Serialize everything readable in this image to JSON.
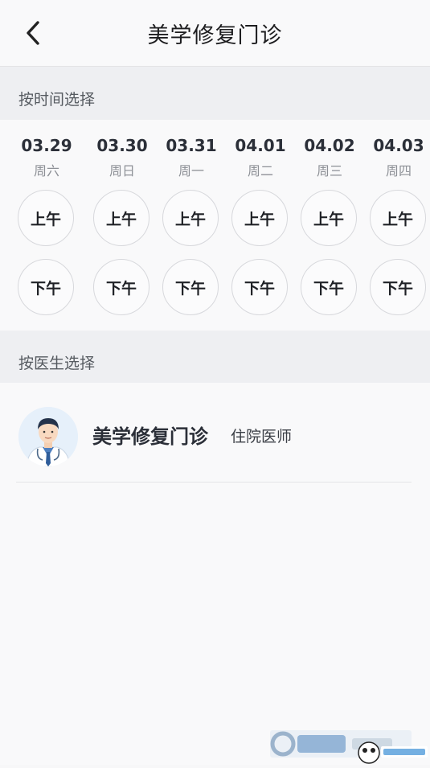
{
  "header": {
    "title": "美学修复门诊",
    "back_icon": "chevron-left-icon"
  },
  "time_section": {
    "label": "按时间选择",
    "days": [
      {
        "date": "03.29",
        "weekday": "周六",
        "am": "上午",
        "pm": "下午"
      },
      {
        "date": "03.30",
        "weekday": "周日",
        "am": "上午",
        "pm": "下午"
      },
      {
        "date": "03.31",
        "weekday": "周一",
        "am": "上午",
        "pm": "下午"
      },
      {
        "date": "04.01",
        "weekday": "周二",
        "am": "上午",
        "pm": "下午"
      },
      {
        "date": "04.02",
        "weekday": "周三",
        "am": "上午",
        "pm": "下午"
      },
      {
        "date": "04.03",
        "weekday": "周四",
        "am": "上午",
        "pm": "下午"
      }
    ]
  },
  "doctor_section": {
    "label": "按医生选择",
    "doctors": [
      {
        "name": "美学修复门诊",
        "title": "住院医师",
        "avatar_icon": "doctor-avatar-icon"
      }
    ]
  },
  "colors": {
    "background": "#f7f7f8",
    "section_header_bg": "#eeeff2",
    "text_primary": "#2b2f38",
    "text_secondary": "#8d9096"
  }
}
